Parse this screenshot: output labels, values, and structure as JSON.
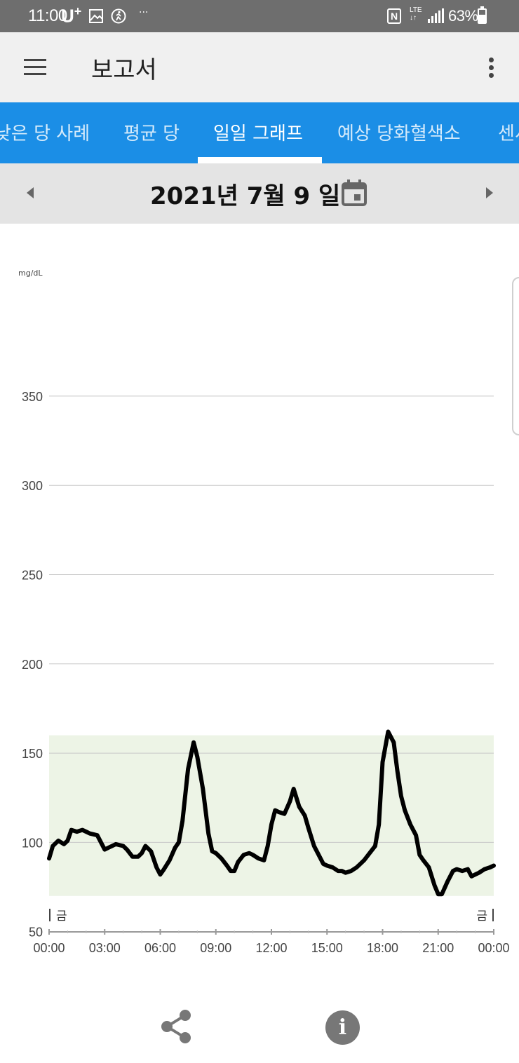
{
  "status_bar": {
    "time": "11:00",
    "carrier": "U",
    "carrier_sup": "+",
    "more": "···",
    "nfc": "N",
    "network_type": "LTE",
    "battery_text": "63%",
    "battery_level": 0.63
  },
  "app_bar": {
    "title": "보고서"
  },
  "tabs": [
    {
      "label": "낮은 당 사례",
      "active": false
    },
    {
      "label": "평균 당",
      "active": false
    },
    {
      "label": "일일 그래프",
      "active": true
    },
    {
      "label": "예상 당화혈색소",
      "active": false
    },
    {
      "label": "센서",
      "active": false
    }
  ],
  "date_nav": {
    "date": "2021년 7월 9 일"
  },
  "colors": {
    "tab_bar": "#1b8ee6",
    "target_band": "#edf4e6",
    "line": "#000000",
    "grid": "#c8c8c8"
  },
  "chart_data": {
    "type": "line",
    "unit_label": "mg/dL",
    "y_ticks": [
      "350",
      "300",
      "250",
      "200",
      "150",
      "100",
      "50"
    ],
    "ylim": [
      0,
      350
    ],
    "x_ticks": [
      "00:00",
      "03:00",
      "06:00",
      "09:00",
      "12:00",
      "15:00",
      "18:00",
      "21:00",
      "00:00"
    ],
    "xlim_hours": [
      0,
      24
    ],
    "day_label_start": "금",
    "day_label_end": "금",
    "target_range": [
      70,
      160
    ],
    "grid": true,
    "series": [
      {
        "x": [
          0,
          0.2,
          0.5,
          0.8,
          1.0,
          1.2,
          1.5,
          1.8,
          2.0,
          2.2,
          2.6,
          3.0,
          3.2,
          3.6,
          4.0,
          4.2,
          4.5,
          4.8,
          5.0,
          5.2,
          5.5,
          5.8,
          6.0,
          6.2,
          6.5,
          6.8,
          7.0,
          7.2,
          7.5,
          7.8,
          8.0,
          8.3,
          8.6,
          8.8,
          9.0,
          9.3,
          9.6,
          9.8,
          10.0,
          10.2,
          10.5,
          10.8,
          11.0,
          11.3,
          11.6,
          11.8,
          12.0,
          12.2,
          12.4,
          12.7,
          13.0,
          13.2,
          13.5,
          13.8,
          14.0,
          14.3,
          14.6,
          14.8,
          15.0,
          15.3,
          15.6,
          15.8,
          16.0,
          16.3,
          16.6,
          16.8,
          17.0,
          17.3,
          17.6,
          17.8,
          18.0,
          18.3,
          18.6,
          18.8,
          19.0,
          19.2,
          19.5,
          19.8,
          20.0,
          20.2,
          20.5,
          20.8,
          21.0,
          21.2,
          21.5,
          21.8,
          22.0,
          22.3,
          22.6,
          22.8,
          23.0,
          23.2,
          23.5,
          23.8,
          24.0
        ],
        "y": [
          91,
          98,
          101,
          99,
          101,
          107,
          106,
          107,
          106,
          105,
          104,
          96,
          97,
          99,
          98,
          96,
          92,
          92,
          94,
          98,
          95,
          86,
          82,
          85,
          90,
          97,
          100,
          112,
          141,
          156,
          148,
          130,
          105,
          95,
          94,
          91,
          87,
          84,
          84,
          89,
          93,
          94,
          93,
          91,
          90,
          98,
          110,
          118,
          117,
          116,
          123,
          130,
          120,
          115,
          108,
          98,
          92,
          88,
          87,
          86,
          84,
          84,
          83,
          84,
          86,
          88,
          90,
          94,
          98,
          110,
          145,
          162,
          156,
          140,
          126,
          118,
          110,
          104,
          93,
          90,
          86,
          76,
          71,
          71,
          78,
          84,
          85,
          84,
          85,
          81,
          82,
          83,
          85,
          86,
          87
        ]
      }
    ]
  }
}
